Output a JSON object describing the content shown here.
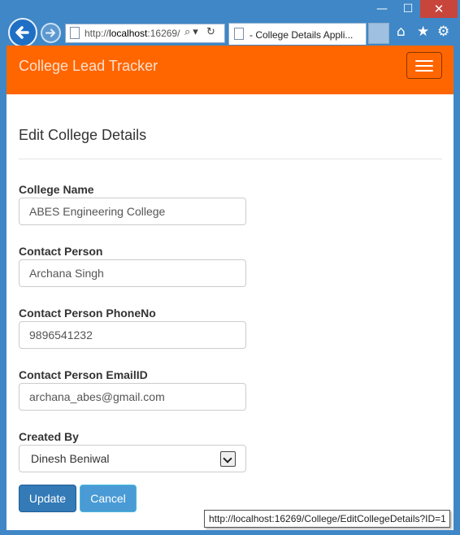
{
  "browser": {
    "url": {
      "prefix": "http://",
      "host": "localhost",
      "rest": ":16269/",
      "icons": "⌕▾ ↻"
    },
    "tab_title": "- College Details Appli...",
    "window_controls": {
      "minimize": "—",
      "maximize": "☐",
      "close": "✕"
    },
    "toolbar_icons": {
      "home": "⌂",
      "star": "★",
      "gear": "⚙"
    },
    "status_url": "http://localhost:16269/College/EditCollegeDetails?ID=1"
  },
  "navbar": {
    "brand": "College Lead Tracker",
    "accent_color": "#ff6600"
  },
  "page": {
    "heading": "Edit College Details"
  },
  "form": {
    "college_name": {
      "label": "College Name",
      "value": "ABES Engineering College"
    },
    "contact_person": {
      "label": "Contact Person",
      "value": "Archana Singh"
    },
    "contact_phone": {
      "label": "Contact Person PhoneNo",
      "value": "9896541232"
    },
    "contact_email": {
      "label": "Contact Person EmailID",
      "value": "archana_abes@gmail.com"
    },
    "created_by": {
      "label": "Created By",
      "selected": "Dinesh Beniwal"
    },
    "update_label": "Update",
    "cancel_label": "Cancel"
  }
}
